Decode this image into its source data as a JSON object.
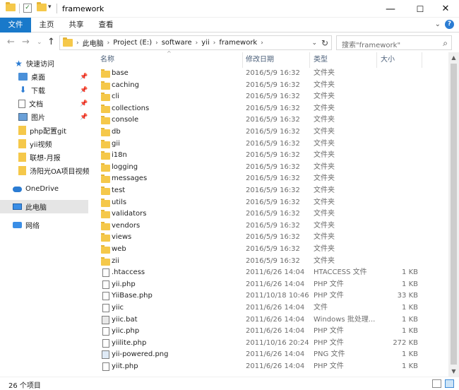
{
  "window": {
    "title": "framework",
    "minimize": "—",
    "maximize": "☐",
    "close": "✕"
  },
  "ribbon": {
    "tabs": [
      "文件",
      "主页",
      "共享",
      "查看"
    ]
  },
  "address": {
    "crumbs": [
      "此电脑",
      "Project (E:)",
      "software",
      "yii",
      "framework"
    ],
    "search_placeholder": "搜索\"framework\""
  },
  "nav": {
    "quick_access": "快速访问",
    "pinned": [
      {
        "label": "桌面",
        "icon": "desktop-icon"
      },
      {
        "label": "下载",
        "icon": "download-icon"
      },
      {
        "label": "文档",
        "icon": "document-icon"
      },
      {
        "label": "图片",
        "icon": "pictures-icon"
      }
    ],
    "recent": [
      "php配置git",
      "yii视频",
      "联想-月报",
      "汤阳光OA项目视频"
    ],
    "onedrive": "OneDrive",
    "this_pc": "此电脑",
    "network": "网络"
  },
  "columns": {
    "name": "名称",
    "date": "修改日期",
    "type": "类型",
    "size": "大小"
  },
  "files": [
    {
      "name": "base",
      "date": "2016/5/9 16:32",
      "type": "文件夹",
      "size": "",
      "kind": "folder"
    },
    {
      "name": "caching",
      "date": "2016/5/9 16:32",
      "type": "文件夹",
      "size": "",
      "kind": "folder"
    },
    {
      "name": "cli",
      "date": "2016/5/9 16:32",
      "type": "文件夹",
      "size": "",
      "kind": "folder"
    },
    {
      "name": "collections",
      "date": "2016/5/9 16:32",
      "type": "文件夹",
      "size": "",
      "kind": "folder"
    },
    {
      "name": "console",
      "date": "2016/5/9 16:32",
      "type": "文件夹",
      "size": "",
      "kind": "folder"
    },
    {
      "name": "db",
      "date": "2016/5/9 16:32",
      "type": "文件夹",
      "size": "",
      "kind": "folder"
    },
    {
      "name": "gii",
      "date": "2016/5/9 16:32",
      "type": "文件夹",
      "size": "",
      "kind": "folder"
    },
    {
      "name": "i18n",
      "date": "2016/5/9 16:32",
      "type": "文件夹",
      "size": "",
      "kind": "folder"
    },
    {
      "name": "logging",
      "date": "2016/5/9 16:32",
      "type": "文件夹",
      "size": "",
      "kind": "folder"
    },
    {
      "name": "messages",
      "date": "2016/5/9 16:32",
      "type": "文件夹",
      "size": "",
      "kind": "folder"
    },
    {
      "name": "test",
      "date": "2016/5/9 16:32",
      "type": "文件夹",
      "size": "",
      "kind": "folder"
    },
    {
      "name": "utils",
      "date": "2016/5/9 16:32",
      "type": "文件夹",
      "size": "",
      "kind": "folder"
    },
    {
      "name": "validators",
      "date": "2016/5/9 16:32",
      "type": "文件夹",
      "size": "",
      "kind": "folder"
    },
    {
      "name": "vendors",
      "date": "2016/5/9 16:32",
      "type": "文件夹",
      "size": "",
      "kind": "folder"
    },
    {
      "name": "views",
      "date": "2016/5/9 16:32",
      "type": "文件夹",
      "size": "",
      "kind": "folder"
    },
    {
      "name": "web",
      "date": "2016/5/9 16:32",
      "type": "文件夹",
      "size": "",
      "kind": "folder"
    },
    {
      "name": "zii",
      "date": "2016/5/9 16:32",
      "type": "文件夹",
      "size": "",
      "kind": "folder"
    },
    {
      "name": ".htaccess",
      "date": "2011/6/26 14:04",
      "type": "HTACCESS 文件",
      "size": "1 KB",
      "kind": "file"
    },
    {
      "name": "yii.php",
      "date": "2011/6/26 14:04",
      "type": "PHP 文件",
      "size": "1 KB",
      "kind": "file"
    },
    {
      "name": "YiiBase.php",
      "date": "2011/10/18 10:46",
      "type": "PHP 文件",
      "size": "33 KB",
      "kind": "file"
    },
    {
      "name": "yiic",
      "date": "2011/6/26 14:04",
      "type": "文件",
      "size": "1 KB",
      "kind": "file"
    },
    {
      "name": "yiic.bat",
      "date": "2011/6/26 14:04",
      "type": "Windows 批处理...",
      "size": "1 KB",
      "kind": "bat"
    },
    {
      "name": "yiic.php",
      "date": "2011/6/26 14:04",
      "type": "PHP 文件",
      "size": "1 KB",
      "kind": "file"
    },
    {
      "name": "yiilite.php",
      "date": "2011/10/16 20:24",
      "type": "PHP 文件",
      "size": "272 KB",
      "kind": "file"
    },
    {
      "name": "yii-powered.png",
      "date": "2011/6/26 14:04",
      "type": "PNG 文件",
      "size": "1 KB",
      "kind": "png"
    },
    {
      "name": "yiit.php",
      "date": "2011/6/26 14:04",
      "type": "PHP 文件",
      "size": "1 KB",
      "kind": "file"
    }
  ],
  "status": {
    "count": "26 个项目"
  }
}
